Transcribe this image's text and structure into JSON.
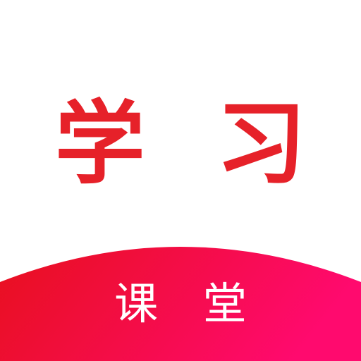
{
  "app_icon": {
    "title": "学 习",
    "subtitle": "课 堂"
  },
  "colors": {
    "background": "#ffffff",
    "title_color": "#e62129",
    "banner_gradient_start": "#e8101e",
    "banner_gradient_end": "#ff0a6e",
    "subtitle_color": "#ffffff"
  }
}
